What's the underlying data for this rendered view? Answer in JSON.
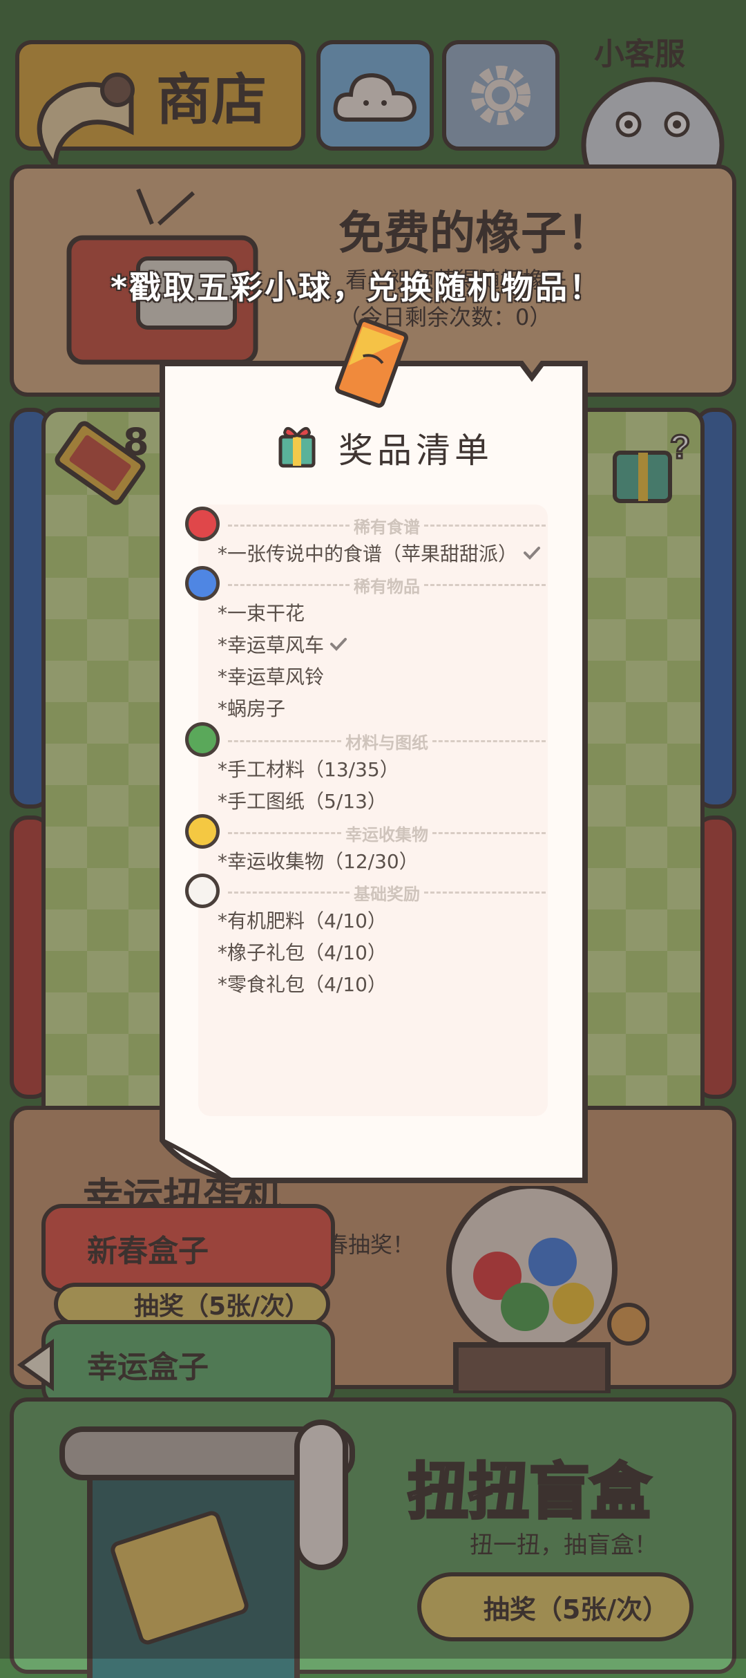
{
  "top_bar": {
    "shop_label": "商店",
    "service_label": "小客服"
  },
  "free_acorns": {
    "title": "免费的橡子！",
    "subtitle": "看小视频获得随机橡子",
    "remaining": "（今日剩余次数：0）"
  },
  "ticket_count": "8",
  "banner": "*戳取五彩小球，兑换随机物品！",
  "prize_list": {
    "title": "奖品清单",
    "sections": [
      {
        "ball": "red",
        "title": "稀有食谱",
        "items": [
          {
            "text": "*一张传说中的食谱（苹果甜甜派）",
            "checked": true
          }
        ]
      },
      {
        "ball": "blue",
        "title": "稀有物品",
        "items": [
          {
            "text": "*一束干花",
            "checked": false
          },
          {
            "text": "*幸运草风车",
            "checked": true
          },
          {
            "text": "*幸运草风铃",
            "checked": false
          },
          {
            "text": "*蜗房子",
            "checked": false
          }
        ]
      },
      {
        "ball": "green",
        "title": "材料与图纸",
        "items": [
          {
            "text": "*手工材料（13/35）",
            "checked": false
          },
          {
            "text": "*手工图纸（5/13）",
            "checked": false
          }
        ]
      },
      {
        "ball": "yellow",
        "title": "幸运收集物",
        "items": [
          {
            "text": "*幸运收集物（12/30）",
            "checked": false
          }
        ]
      },
      {
        "ball": "white",
        "title": "基础奖励",
        "items": [
          {
            "text": "*有机肥料（4/10）",
            "checked": false
          },
          {
            "text": "*橡子礼包（4/10）",
            "checked": false
          },
          {
            "text": "*零食礼包（4/10）",
            "checked": false
          }
        ]
      }
    ]
  },
  "gacha": {
    "title": "幸运扭蛋机",
    "subtitle": "新春抽奖！",
    "box1": "新春盒子",
    "draw1": "抽奖（5张/次）",
    "box2": "幸运盒子"
  },
  "blind_box": {
    "title": "扭扭盲盒",
    "subtitle": "扭一扭，抽盲盒！",
    "draw": "抽奖（5张/次）"
  },
  "colors": {
    "red": "#e0474a",
    "blue": "#4f86e3",
    "green": "#5aa85a",
    "yellow": "#f4c842",
    "white": "#f7f3ef",
    "ink": "#4a3f3a",
    "paper": "#fffaf6"
  }
}
